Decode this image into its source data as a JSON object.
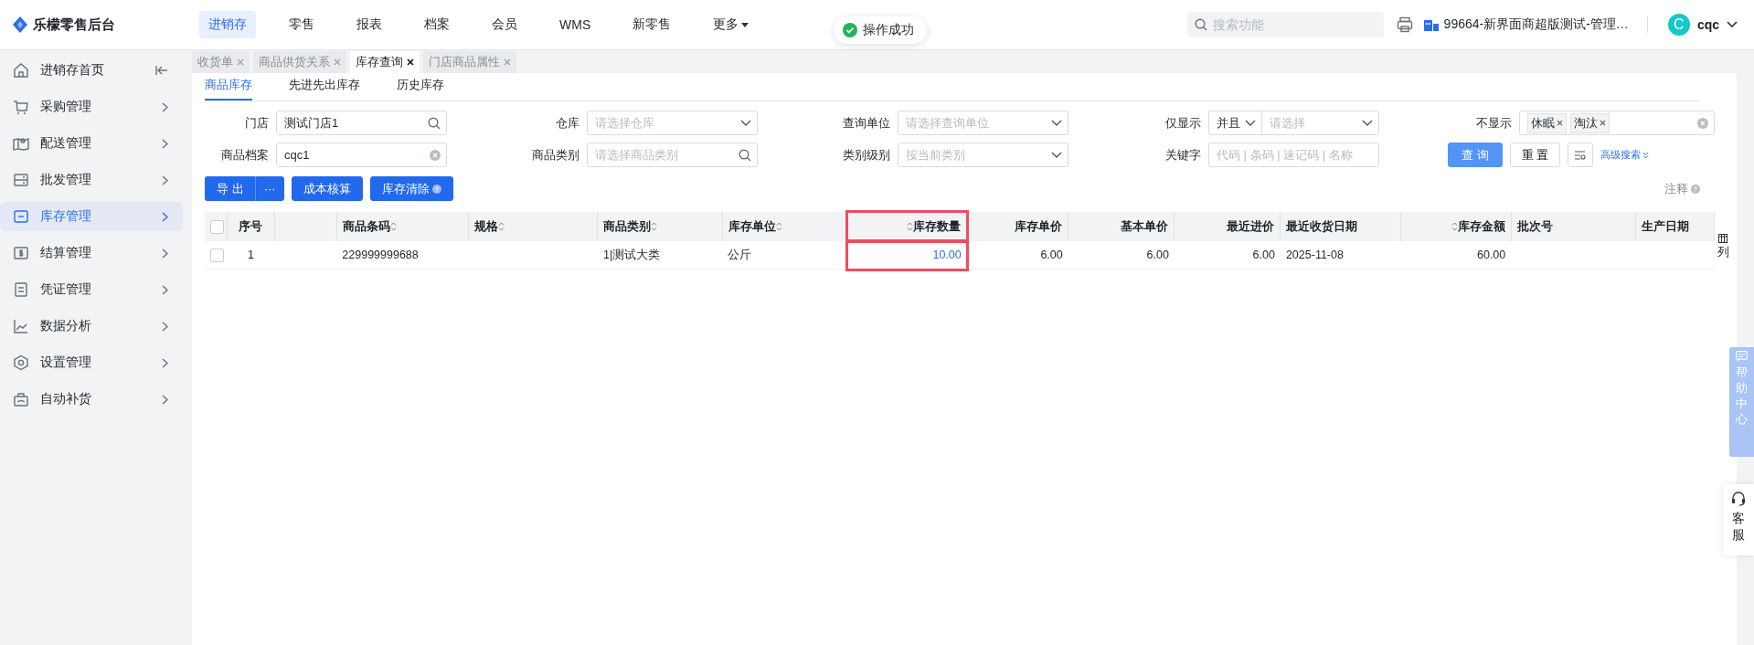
{
  "app": {
    "title": "乐檬零售后台"
  },
  "top_nav": [
    {
      "label": "进销存",
      "selected": true
    },
    {
      "label": "零售",
      "selected": false
    },
    {
      "label": "报表",
      "selected": false
    },
    {
      "label": "档案",
      "selected": false
    },
    {
      "label": "会员",
      "selected": false
    },
    {
      "label": "WMS",
      "selected": false
    },
    {
      "label": "新零售",
      "selected": false
    },
    {
      "label": "更多",
      "selected": false,
      "kind": "dropdown"
    }
  ],
  "toast": "操作成功",
  "search": {
    "placeholder": "搜索功能"
  },
  "store": "99664-新界面商超版测试-管理…",
  "user": {
    "initial": "C",
    "name": "cqc"
  },
  "sidebar": [
    {
      "label": "进销存首页",
      "selected": false,
      "kind": "collapse"
    },
    {
      "label": "采购管理",
      "selected": false,
      "kind": "menu"
    },
    {
      "label": "配送管理",
      "selected": false,
      "kind": "menu"
    },
    {
      "label": "批发管理",
      "selected": false,
      "kind": "menu"
    },
    {
      "label": "库存管理",
      "selected": true,
      "kind": "menu"
    },
    {
      "label": "结算管理",
      "selected": false,
      "kind": "menu"
    },
    {
      "label": "凭证管理",
      "selected": false,
      "kind": "menu"
    },
    {
      "label": "数据分析",
      "selected": false,
      "kind": "menu"
    },
    {
      "label": "设置管理",
      "selected": false,
      "kind": "menu"
    },
    {
      "label": "自动补货",
      "selected": false,
      "kind": "menu"
    }
  ],
  "page_tabs": [
    {
      "label": "收货单",
      "selected": false
    },
    {
      "label": "商品供货关系",
      "selected": false
    },
    {
      "label": "库存查询",
      "selected": true
    },
    {
      "label": "门店商品属性",
      "selected": false
    }
  ],
  "sub_tabs": [
    {
      "label": "商品库存",
      "selected": true
    },
    {
      "label": "先进先出库存",
      "selected": false
    },
    {
      "label": "历史库存",
      "selected": false
    }
  ],
  "filters": [
    {
      "label": "门店",
      "kind": "search",
      "value": "测试门店1"
    },
    {
      "label": "仓库",
      "kind": "select",
      "placeholder": "请选择仓库"
    },
    {
      "label": "查询单位",
      "kind": "select",
      "placeholder": "请选择查询单位"
    },
    {
      "label": "仅显示",
      "kind": "combo",
      "value": "并且",
      "placeholder": "请选择"
    },
    {
      "label": "不显示",
      "kind": "tags",
      "tags": [
        "休眠",
        "淘汰"
      ]
    },
    {
      "label": "商品档案",
      "kind": "clear",
      "value": "cqc1"
    },
    {
      "label": "商品类别",
      "kind": "search",
      "placeholder": "请选择商品类别"
    },
    {
      "label": "类别级别",
      "kind": "select",
      "placeholder": "按当前类别"
    },
    {
      "label": "关键字",
      "kind": "text",
      "placeholder": "代码 | 条码 | 速记码 | 名称"
    }
  ],
  "filter_actions": [
    {
      "label": "查 询",
      "kind": "primary"
    },
    {
      "label": "重 置",
      "kind": "plain"
    },
    {
      "kind": "icon"
    },
    {
      "label": "高级搜索",
      "kind": "link"
    }
  ],
  "toolbar": [
    {
      "label": "导 出",
      "kind": "split",
      "more": "···"
    },
    {
      "label": "成本核算",
      "kind": "plain"
    },
    {
      "label": "库存清除",
      "kind": "help"
    }
  ],
  "note": "注释",
  "table": {
    "select_all_checked": false,
    "columns": [
      {
        "label": "序号",
        "kind": "text"
      },
      {
        "kind": "blank"
      },
      {
        "label": "商品条码",
        "kind": "text",
        "sortable": true
      },
      {
        "label": "规格",
        "kind": "text",
        "sortable": true
      },
      {
        "label": "商品类别",
        "kind": "text",
        "sortable": true
      },
      {
        "label": "库存单位",
        "kind": "text",
        "sortable": true
      },
      {
        "label": "库存数量",
        "kind": "num",
        "sortable": true,
        "highlighted": true,
        "link": true
      },
      {
        "label": "库存单价",
        "kind": "num"
      },
      {
        "label": "基本单价",
        "kind": "num"
      },
      {
        "label": "最近进价",
        "kind": "num"
      },
      {
        "label": "最近收货日期",
        "kind": "text"
      },
      {
        "label": "库存金额",
        "kind": "num",
        "sortable": true
      },
      {
        "label": "批次号",
        "kind": "text"
      },
      {
        "label": "生产日期",
        "kind": "text"
      }
    ],
    "rows": [
      {
        "checked": false,
        "cells": [
          "1",
          "",
          "229999999688",
          "",
          "1|测试大类",
          "公斤",
          "10.00",
          "6.00",
          "6.00",
          "6.00",
          "2025-11-08",
          "60.00",
          "",
          ""
        ]
      }
    ],
    "column_settings": "列"
  },
  "help_center": "帮助中心",
  "customer_service": "客服"
}
